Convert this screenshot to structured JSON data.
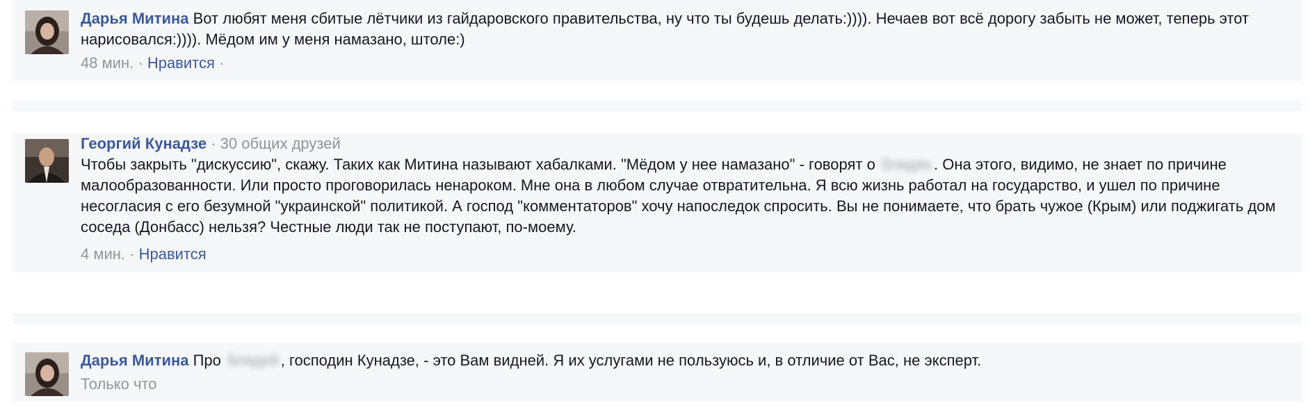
{
  "comments": [
    {
      "author": "Дарья Митина",
      "text_before": " Вот любят меня сбитые лётчики из гайдаровского правительства, ну что ты будешь делать:)))). Нечаев вот всё дорогу забыть не может, теперь этот нарисовался:)))). Мёдом им у меня намазано, штоле:)",
      "time": "48 мин.",
      "dot1": " · ",
      "like": "Нравится",
      "dot2": " ·"
    },
    {
      "author": "Георгий Кунадзе",
      "mutual": " · 30 общих друзей",
      "text_before": "Чтобы закрыть \"дискуссию\", скажу. Таких как Митина называют хабалками. \"Мёдом у нее намазано\" - говорят о ",
      "blurred_word": "блядях",
      "text_after": ". Она этого, видимо, не знает по причине малообразованности. Или просто проговорилась ненароком. Мне она в любом случае отвратительна. Я всю жизнь работал на государство, и ушел по причине несогласия с его безумной \"украинской\" политикой. А господ \"комментаторов\" хочу напоследок спросить. Вы не понимаете, что брать чужое (Крым) или поджигать дом соседа (Донбасс) нельзя? Честные люди так не поступают, по-моему.",
      "time": "4 мин.",
      "dot1": " · ",
      "like": "Нравится"
    },
    {
      "author": "Дарья Митина",
      "text_before": " Про ",
      "blurred_word": "блядей",
      "text_after": ", господин Кунадзе, - это Вам видней. Я их услугами не пользуюсь и, в отличие от Вас, не эксперт.",
      "time": "Только что"
    }
  ],
  "colors": {
    "author": "#3b5998",
    "meta": "#90949c",
    "panel": "#f6f7f9",
    "text": "#141823"
  }
}
